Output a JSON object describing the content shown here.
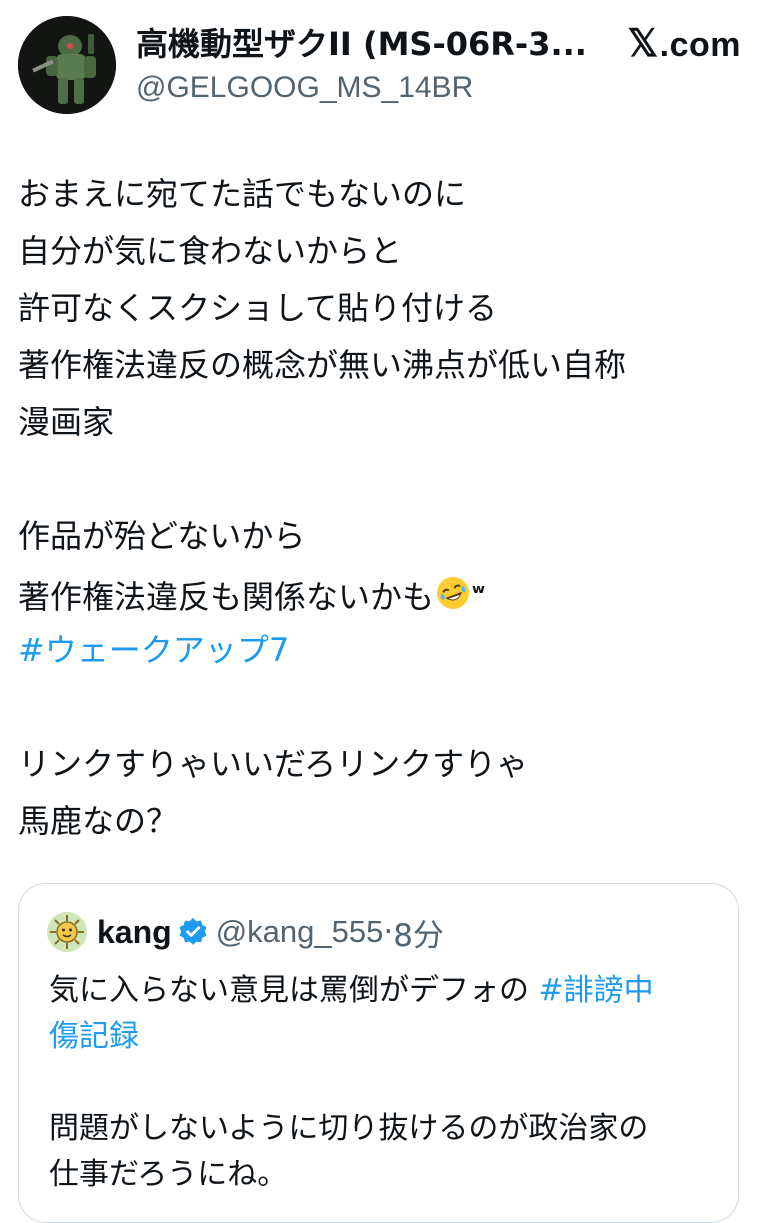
{
  "author": {
    "display_name": "高機動型ザクII (MS-06R-3...",
    "handle": "@GELGOOG_MS_14BR",
    "site": ".com",
    "site_mark": "𝕏"
  },
  "tweet": {
    "lines": [
      "おまえに宛てた話でもないのに",
      "自分が気に食わないからと",
      "許可なくスクショして貼り付ける",
      "著作権法違反の概念が無い沸点が低い自称",
      "漫画家",
      "",
      "作品が殆どないから"
    ],
    "line_emoji_prefix": "著作権法違反も関係ないかも",
    "line_emoji_suffix": "ʷ",
    "emoji_name": "rofl-emoji",
    "hashtag": "#ウェークアップ7",
    "lines_after": [
      "",
      "リンクすりゃいいだろリンクすりゃ",
      "馬鹿なの？"
    ]
  },
  "quote": {
    "name": "kang",
    "handle": "@kang_555",
    "separator": "·",
    "time": "8分",
    "line1_text": "気に入らない意見は罵倒がデフォの ",
    "line1_hashtag": "#誹謗中",
    "line2_hashtag": "傷記録",
    "line3": "",
    "line4": "問題がしないように切り抜けるのが政治家の",
    "line5": "仕事だろうにね。"
  },
  "colors": {
    "text": "#0f1419",
    "secondary": "#536471",
    "link": "#1d9bf0",
    "border": "#cfd9de",
    "verified": "#1d9bf0"
  }
}
